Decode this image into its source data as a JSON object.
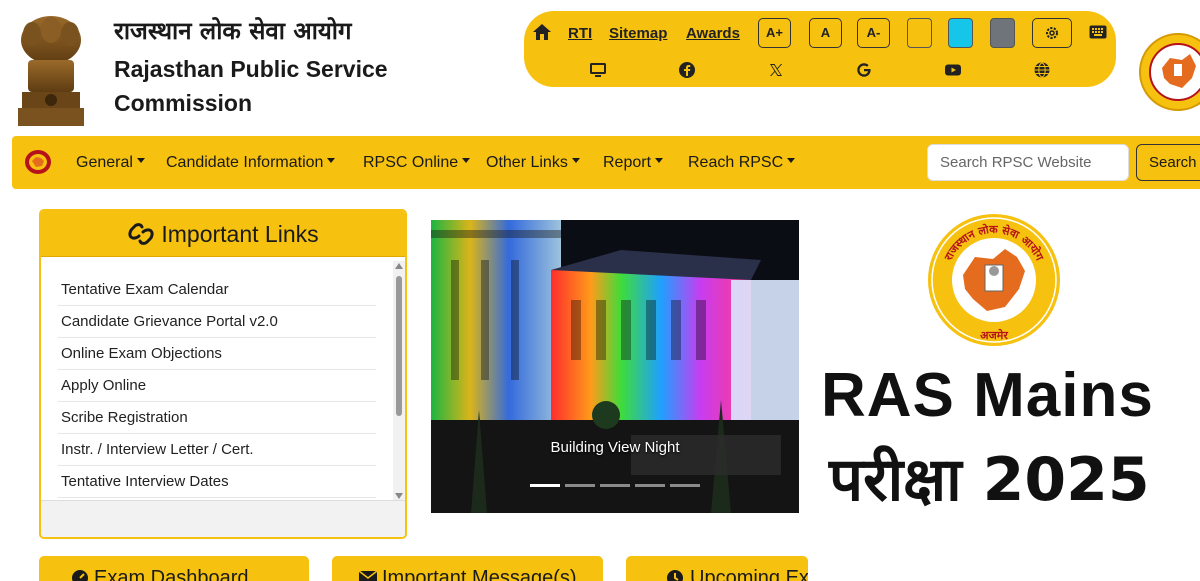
{
  "header": {
    "org_name_hindi": "राजस्थान लोक सेवा आयोग",
    "org_name_line1": "Rajasthan Public Service",
    "org_name_line2": "Commission"
  },
  "utility_bar": {
    "links": [
      "RTI",
      "Sitemap",
      "Awards"
    ],
    "font_sizes": [
      "A+",
      "A",
      "A-"
    ],
    "themes": [
      "#f6c10f",
      "#16c6e8",
      "#6f737a"
    ],
    "icons": [
      "home-icon",
      "gear-icon",
      "keyboard-icon",
      "desktop-icon",
      "facebook-icon",
      "x-icon",
      "google-icon",
      "youtube-icon",
      "globe-icon"
    ]
  },
  "nav": {
    "items": [
      "General",
      "Candidate Information",
      "RPSC Online",
      "Other Links",
      "Report",
      "Reach RPSC"
    ],
    "search_placeholder": "Search RPSC Website",
    "search_button": "Search"
  },
  "important_links": {
    "title": "Important Links",
    "items": [
      "Tentative Exam Calendar",
      "Candidate Grievance Portal v2.0",
      "Online Exam Objections",
      "Apply Online",
      "Scribe Registration",
      "Instr. / Interview Letter / Cert.",
      "Tentative Interview Dates"
    ]
  },
  "carousel": {
    "caption": "Building View Night",
    "slide_count": 5,
    "active_slide": 1
  },
  "promo": {
    "seal_text_top": "राजस्थान लोक सेवा आयोग",
    "seal_text_bottom": "अजमेर",
    "line1": "RAS Mains",
    "line2": "परीक्षा 2025"
  },
  "bottom_cards": [
    "Exam Dashboard",
    "Important Message(s)",
    "Upcoming Ex"
  ],
  "colors": {
    "brand_yellow": "#f6c10f",
    "text_dark": "#1a1a1a"
  }
}
